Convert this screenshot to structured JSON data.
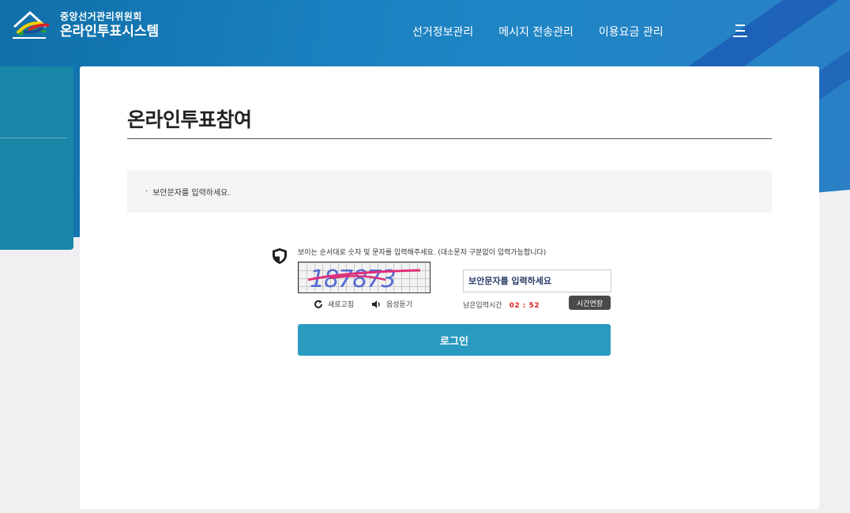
{
  "header": {
    "org_name": "중앙선거관리위원회",
    "system_name": "온라인투표시스템",
    "nav": [
      {
        "label": "선거정보관리"
      },
      {
        "label": "메시지 전송관리"
      },
      {
        "label": "이용요금 관리"
      }
    ],
    "menu_icon": "hamburger-menu-icon"
  },
  "page": {
    "title": "온라인투표참여",
    "notice_bullet": "·",
    "notice": "보안문자를 입력하세요."
  },
  "captcha": {
    "guide": "보이는 순서대로 숫자 및 문자를 입력해주세요. (대소문자 구분없이 입력가능합니다)",
    "image_text": "187873",
    "refresh_label": "새로고침",
    "voice_label": "음성듣기",
    "input_placeholder": "보안문자를 입력하세요",
    "input_value": "",
    "remaining_label": "남은입력시간",
    "remaining_time": "02 : 52",
    "extend_label": "시간연장"
  },
  "login": {
    "label": "로그인"
  },
  "colors": {
    "header_blue": "#1a7fbe",
    "side_panel": "#1a86a8",
    "login_button": "#2a9ac0",
    "timer_red": "#e02020",
    "extend_button": "#4a4a4a"
  }
}
